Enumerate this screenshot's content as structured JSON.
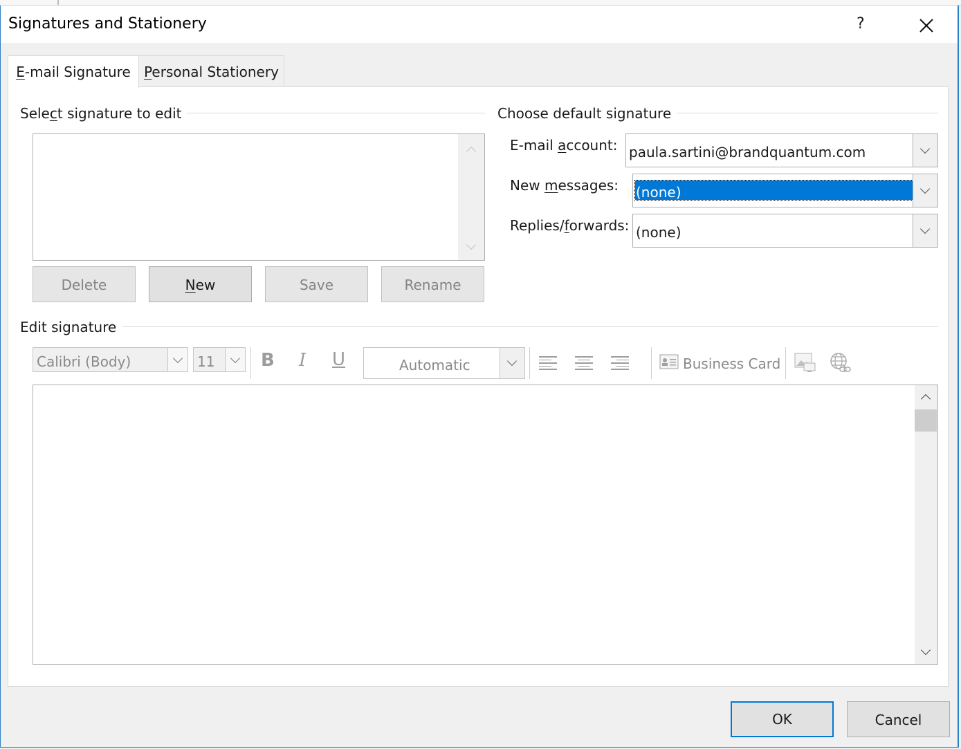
{
  "window": {
    "title": "Signatures and Stationery",
    "help_label": "?",
    "close_icon": "close-icon"
  },
  "tabs": [
    {
      "prefix": "",
      "accel": "E",
      "rest": "-mail Signature",
      "active": true
    },
    {
      "prefix": "",
      "accel": "P",
      "rest": "ersonal Stationery",
      "active": false
    }
  ],
  "select_group": {
    "pre": "Sele",
    "accel": "c",
    "post": "t signature to edit"
  },
  "signature_list": {
    "items": []
  },
  "buttons": {
    "delete": "Delete",
    "new_accel": "N",
    "new_rest": "ew",
    "save": "Save",
    "rename": "Rename"
  },
  "default_group": {
    "label": "Choose default signature",
    "email_label_pre": "E-mail ",
    "email_label_accel": "a",
    "email_label_post": "ccount:",
    "email_value": "paula.sartini@brandquantum.com",
    "new_label_pre": "New ",
    "new_label_accel": "m",
    "new_label_post": "essages:",
    "new_value": "(none)",
    "replies_label_pre": "Replies/",
    "replies_label_accel": "f",
    "replies_label_post": "orwards:",
    "replies_value": "(none)"
  },
  "edit_group": {
    "label": "Edit signature"
  },
  "toolbar": {
    "font": "Calibri (Body)",
    "size": "11",
    "bold": "B",
    "italic": "I",
    "underline": "U",
    "color": "Automatic",
    "business_card": "Business Card"
  },
  "colors": {
    "accent": "#0078d7",
    "selection": "#0078d7"
  },
  "dialog_buttons": {
    "ok": "OK",
    "cancel": "Cancel"
  }
}
